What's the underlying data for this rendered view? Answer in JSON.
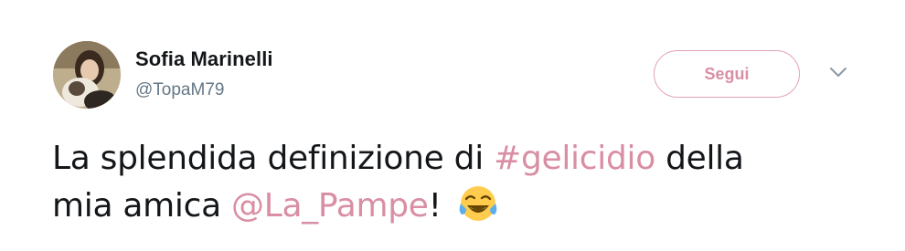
{
  "author": {
    "name": "Sofia Marinelli",
    "handle": "@TopaM79"
  },
  "follow_button": {
    "label": "Segui"
  },
  "tweet": {
    "line1_prefix": "La splendida definizione di ",
    "hashtag": "#gelicidio",
    "line1_suffix": " della",
    "line2_prefix": "mia amica ",
    "mention": "@La_Pampe",
    "line2_suffix": "!",
    "emoji": "face-with-tears-of-joy"
  },
  "colors": {
    "accent": "#d98ea4",
    "text": "#14171a",
    "secondary": "#657786"
  }
}
